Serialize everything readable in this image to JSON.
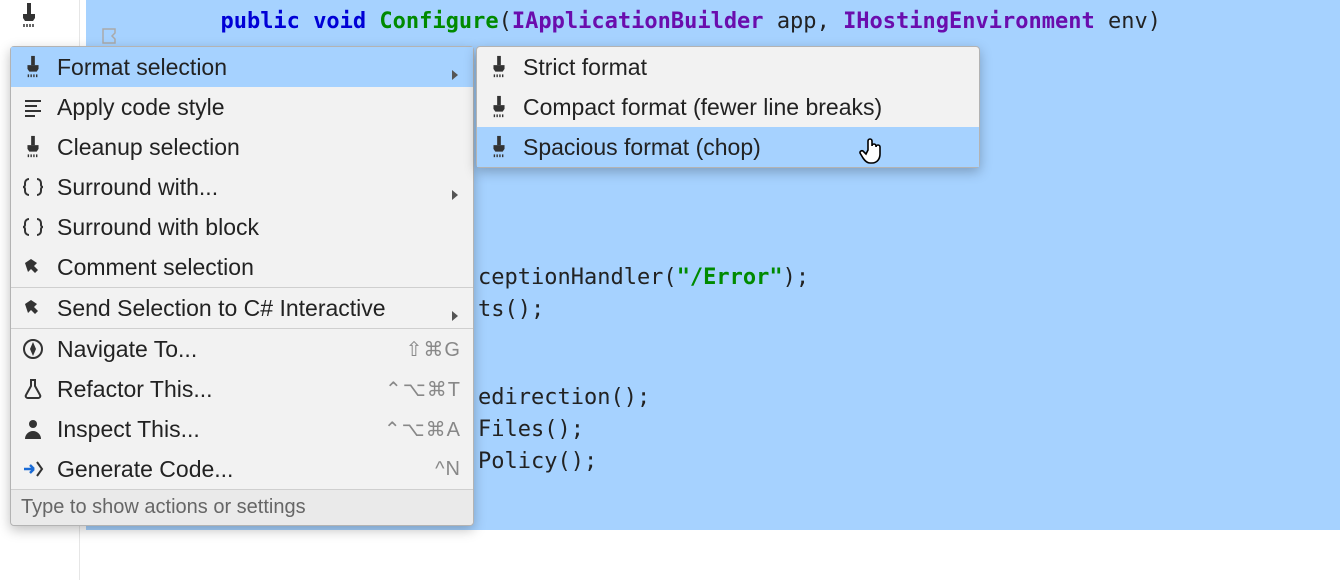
{
  "code": {
    "line1": {
      "prefix_spaces": "          ",
      "kw1": "public",
      "kw2": "void",
      "fn": "Configure",
      "p1_type": "IApplicationBuilder",
      "p1_name": "app",
      "p2_type": "IHostingEnvironment",
      "p2_name": "env"
    },
    "frag1_prefix": "ceptionHandler(",
    "frag1_str": "\"/Error\"",
    "frag1_suffix": ");",
    "frag2": "ts();",
    "frag3": "edirection();",
    "frag4": "Files();",
    "frag5": "Policy();"
  },
  "menu": {
    "items": [
      {
        "label": "Format selection",
        "icon": "brush",
        "submenu": true,
        "highlight": true
      },
      {
        "label": "Apply code style",
        "icon": "lines"
      },
      {
        "label": "Cleanup selection",
        "icon": "brush"
      },
      {
        "label": "Surround with...",
        "icon": "brackets",
        "submenu": true
      },
      {
        "label": "Surround with block",
        "icon": "brackets"
      },
      {
        "label": "Comment selection",
        "icon": "hammer"
      },
      {
        "sep": true
      },
      {
        "label": "Send Selection to C# Interactive",
        "icon": "hammer",
        "submenu": true
      },
      {
        "sep": true
      },
      {
        "label": "Navigate To...",
        "icon": "compass",
        "shortcut": "⇧⌘G"
      },
      {
        "label": "Refactor This...",
        "icon": "flask",
        "shortcut": "⌃⌥⌘T"
      },
      {
        "label": "Inspect This...",
        "icon": "person",
        "shortcut": "⌃⌥⌘A"
      },
      {
        "label": "Generate Code...",
        "icon": "arrow",
        "shortcut": "^N"
      }
    ],
    "footer": "Type to show actions or settings"
  },
  "submenu": {
    "items": [
      {
        "label": "Strict format",
        "icon": "brush"
      },
      {
        "label": "Compact format (fewer line breaks)",
        "icon": "brush"
      },
      {
        "label": "Spacious format (chop)",
        "icon": "brush",
        "highlight": true
      }
    ]
  }
}
